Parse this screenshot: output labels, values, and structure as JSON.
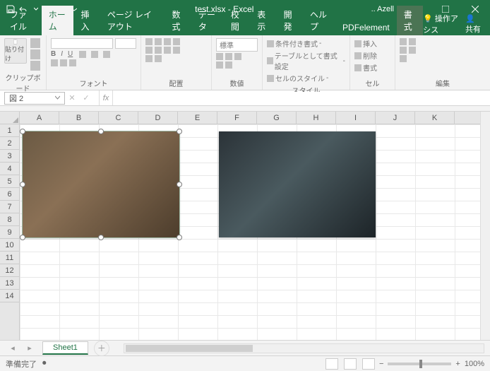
{
  "titlebar": {
    "filename": "test.xlsx  -  Excel",
    "user": ".. Azell"
  },
  "tabs": {
    "file": "ファイル",
    "home": "ホーム",
    "insert": "挿入",
    "pagelayout": "ページ レイアウト",
    "formulas": "数式",
    "data": "データ",
    "review": "校閲",
    "view": "表示",
    "developer": "開発",
    "help": "ヘルプ",
    "pdfelement": "PDFelement",
    "format": "書式",
    "tell_me": "操作アシス",
    "share": "共有"
  },
  "ribbon": {
    "paste": "貼り付け",
    "clipboard": "クリップボード",
    "font": "フォント",
    "alignment": "配置",
    "number_format": "標準",
    "number": "数値",
    "cond_fmt": "条件付き書式",
    "table_fmt": "テーブルとして書式設定",
    "cell_style": "セルのスタイル",
    "styles": "スタイル",
    "insert_cell": "挿入",
    "delete_cell": "削除",
    "format_cell": "書式",
    "cells": "セル",
    "editing": "編集"
  },
  "namebox": "図 2",
  "columns": [
    "A",
    "B",
    "C",
    "D",
    "E",
    "F",
    "G",
    "H",
    "I",
    "J",
    "K"
  ],
  "rows": [
    "1",
    "2",
    "3",
    "4",
    "5",
    "6",
    "7",
    "8",
    "9",
    "10",
    "11",
    "12",
    "13",
    "14"
  ],
  "sheet": {
    "active": "Sheet1"
  },
  "status": {
    "ready": "準備完了",
    "zoom": "100%"
  }
}
